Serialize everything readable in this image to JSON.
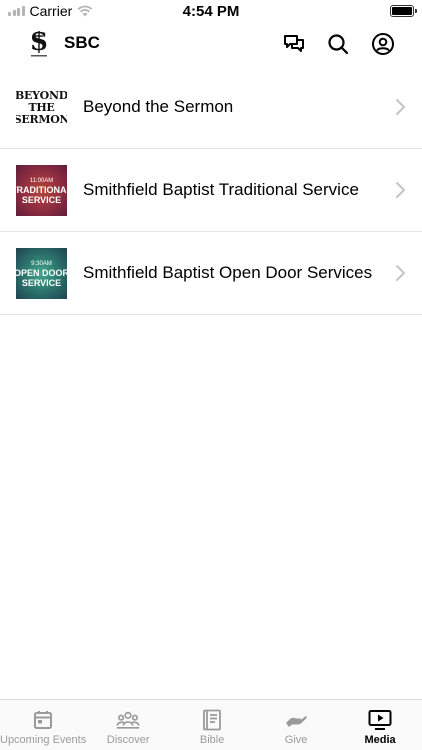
{
  "status_bar": {
    "carrier": "Carrier",
    "time": "4:54 PM",
    "icons": [
      "signal-icon",
      "wifi-icon",
      "battery-icon"
    ]
  },
  "header": {
    "title": "SBC",
    "logo_letter": "S",
    "icons": [
      "chat-icon",
      "search-icon",
      "profile-icon"
    ]
  },
  "media_list": [
    {
      "title": "Beyond the Sermon",
      "thumbnail_text": [
        "BEYOND",
        "THE",
        "SERMON"
      ]
    },
    {
      "title": "Smithfield Baptist Traditional Service",
      "thumbnail_text": [
        "11:00AM",
        "TRADITIONAL",
        "SERVICE"
      ]
    },
    {
      "title": "Smithfield Baptist Open Door Services",
      "thumbnail_text": [
        "9:30AM",
        "OPEN DOOR",
        "SERVICE"
      ]
    }
  ],
  "tab_bar": {
    "tabs": [
      {
        "label": "Upcoming Events",
        "icon": "calendar-icon",
        "active": false
      },
      {
        "label": "Discover",
        "icon": "people-icon",
        "active": false
      },
      {
        "label": "Bible",
        "icon": "book-icon",
        "active": false
      },
      {
        "label": "Give",
        "icon": "hand-icon",
        "active": false
      },
      {
        "label": "Media",
        "icon": "media-icon",
        "active": true
      }
    ]
  },
  "colors": {
    "accent": "#000000",
    "inactive_tab": "#9a9a9a",
    "divider": "#e3e3e3"
  }
}
